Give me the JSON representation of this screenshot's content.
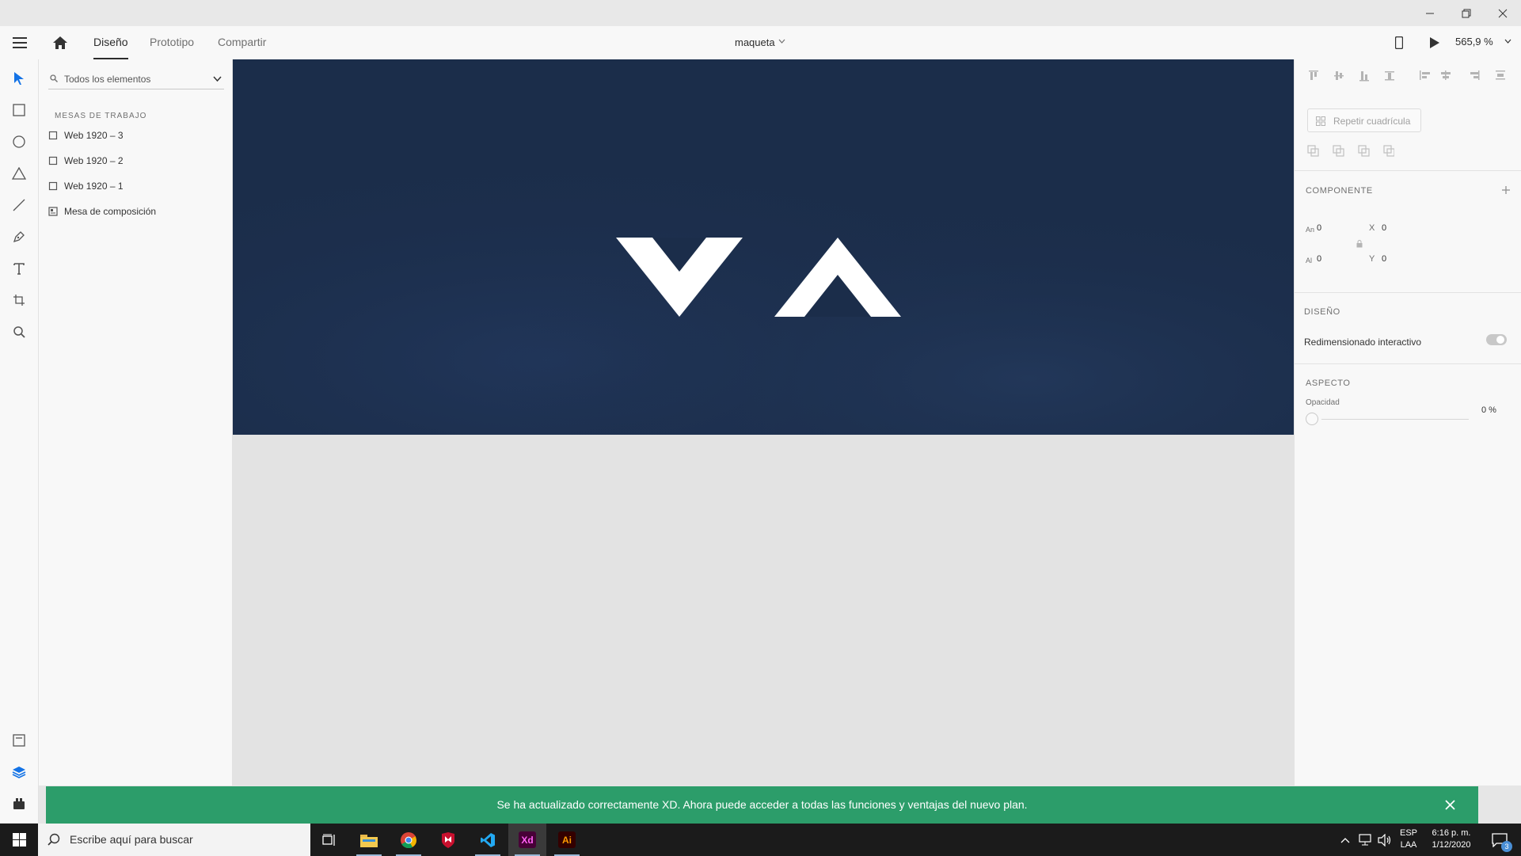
{
  "header": {
    "tabs": [
      {
        "label": "Diseño",
        "active": true
      },
      {
        "label": "Prototipo",
        "active": false
      },
      {
        "label": "Compartir",
        "active": false
      }
    ],
    "doc_title": "maqueta",
    "zoom": "565,9 %"
  },
  "layers": {
    "search_placeholder": "Todos los elementos",
    "section_label": "MESAS DE TRABAJO",
    "items": [
      {
        "label": "Web 1920 – 3",
        "icon": "artboard-icon"
      },
      {
        "label": "Web 1920 – 2",
        "icon": "artboard-icon"
      },
      {
        "label": "Web 1920 – 1",
        "icon": "artboard-icon"
      },
      {
        "label": "Mesa de composición",
        "icon": "pasteboard-icon"
      }
    ]
  },
  "inspector": {
    "repeat_grid": "Repetir cuadrícula",
    "component_label": "COMPONENTE",
    "w_label": "An",
    "w_value": "0",
    "h_label": "Al",
    "h_value": "0",
    "x_label": "X",
    "x_value": "0",
    "y_label": "Y",
    "y_value": "0",
    "layout_label": "DISEÑO",
    "responsive_label": "Redimensionado interactivo",
    "appearance_label": "ASPECTO",
    "opacity_label": "Opacidad",
    "opacity_value": "0 %"
  },
  "toast": {
    "message": "Se ha actualizado correctamente XD. Ahora puede acceder a todas las funciones y ventajas del nuevo plan."
  },
  "taskbar": {
    "search_placeholder": "Escribe aquí para buscar",
    "lang_top": "ESP",
    "lang_bottom": "LAA",
    "time": "6:16 p. m.",
    "date": "1/12/2020",
    "notification_count": "3",
    "xd_label": "Xd",
    "ai_label": "Ai"
  },
  "colors": {
    "artboard_bg": "#1b2d4a",
    "toast_bg": "#2c9d6a",
    "accent": "#1473e6"
  }
}
